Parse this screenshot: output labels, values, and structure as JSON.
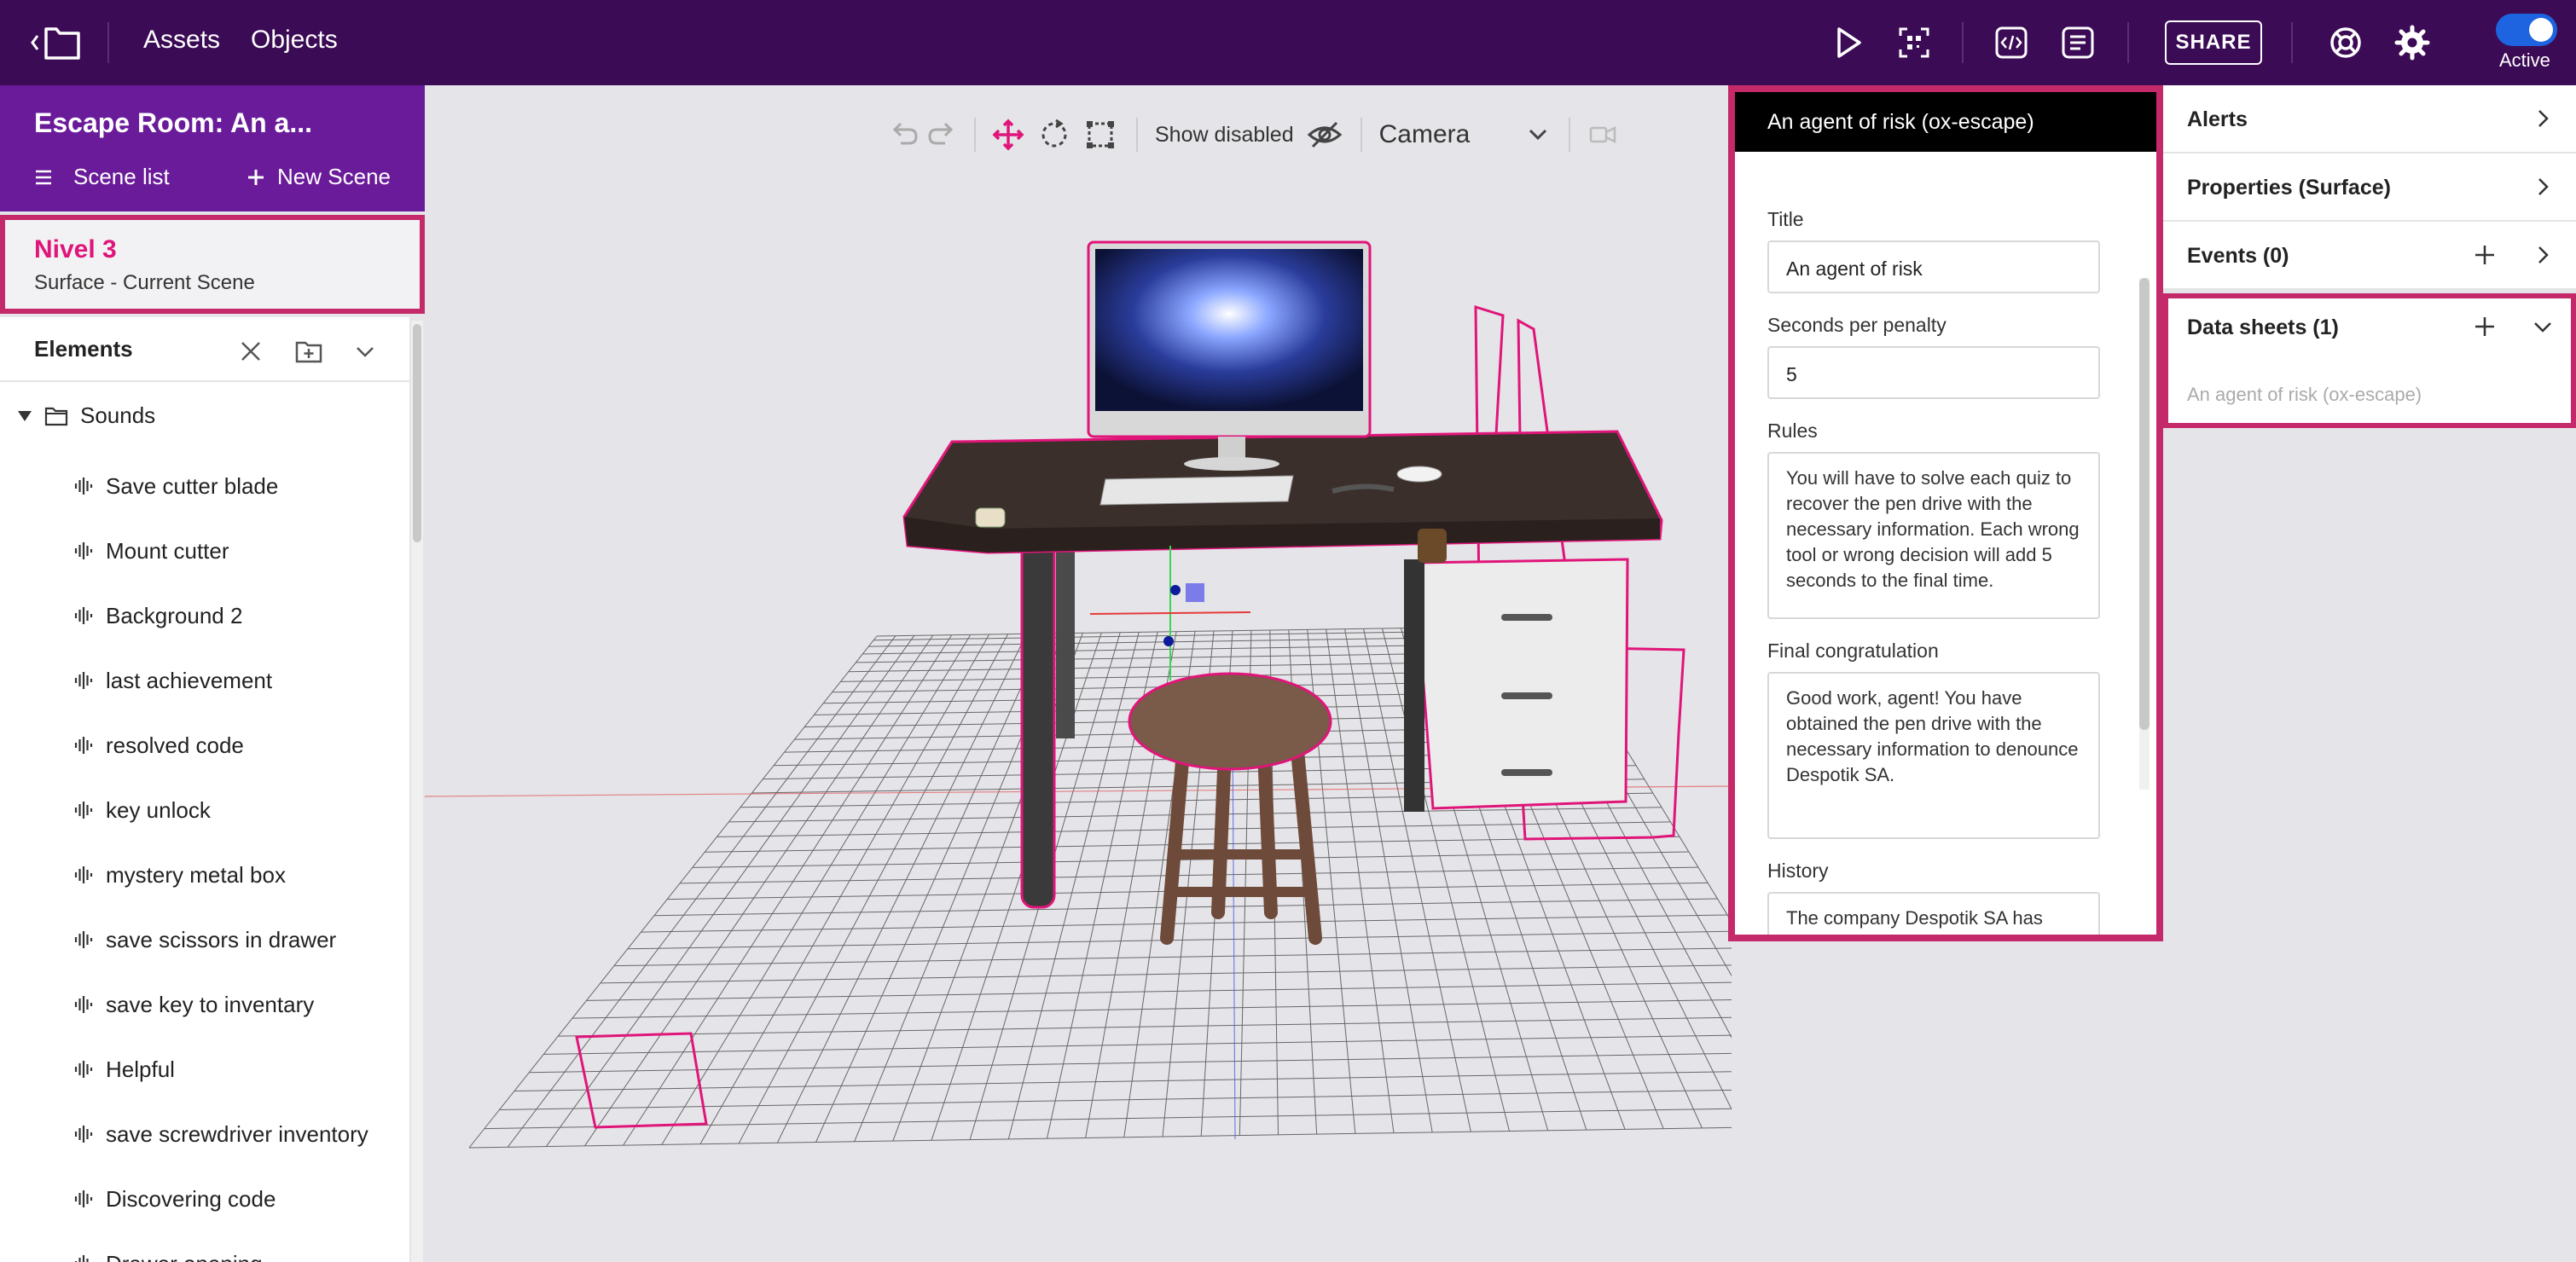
{
  "topbar": {
    "assets_label": "Assets",
    "objects_label": "Objects",
    "share_label": "SHARE",
    "active_label": "Active",
    "icons": [
      "play-icon",
      "qr-scan-icon",
      "code-icon",
      "document-icon",
      "help-icon",
      "gear-icon"
    ]
  },
  "sidebar": {
    "project_title": "Escape Room: An a...",
    "scene_list_label": "Scene list",
    "new_scene_label": "New Scene",
    "current_scene": {
      "name": "Nivel 3",
      "subtitle": "Surface - Current Scene"
    },
    "elements_title": "Elements",
    "folder_label": "Sounds",
    "items": [
      {
        "label": "Save cutter blade"
      },
      {
        "label": "Mount cutter"
      },
      {
        "label": "Background 2"
      },
      {
        "label": "last achievement"
      },
      {
        "label": "resolved code"
      },
      {
        "label": "key unlock"
      },
      {
        "label": "mystery metal box"
      },
      {
        "label": "save scissors in drawer"
      },
      {
        "label": "save key to inventary"
      },
      {
        "label": "Helpful"
      },
      {
        "label": "save screwdriver inventory"
      },
      {
        "label": "Discovering code"
      },
      {
        "label": "Drawer opening"
      }
    ]
  },
  "viewport": {
    "show_disabled_label": "Show disabled",
    "camera_label": "Camera"
  },
  "datasheet": {
    "header": "An agent of risk (ox-escape)",
    "title_label": "Title",
    "title_value": "An agent of risk",
    "penalty_label": "Seconds per penalty",
    "penalty_value": "5",
    "rules_label": "Rules",
    "rules_value": "You will have to solve each quiz to recover the pen drive with the necessary information. Each wrong tool or wrong decision will add 5 seconds to the final time.",
    "congrats_label": "Final congratulation",
    "congrats_value": "Good work, agent! You have obtained the pen drive with the necessary information to denounce Despotik SA.",
    "history_label": "History",
    "history_value": "The company Despotik SA has been denied any responsibility"
  },
  "properties": {
    "alerts_label": "Alerts",
    "properties_label": "Properties (Surface)",
    "events_label": "Events (0)",
    "datasheets_label": "Data sheets (1)",
    "datasheet_item": "An agent of risk (ox-escape)"
  },
  "colors": {
    "topbar": "#3b0b55",
    "sidebar_header": "#6a1b9a",
    "highlight": "#c42a6a",
    "scene_name": "#e0157a",
    "toggle": "#1e63e0"
  }
}
